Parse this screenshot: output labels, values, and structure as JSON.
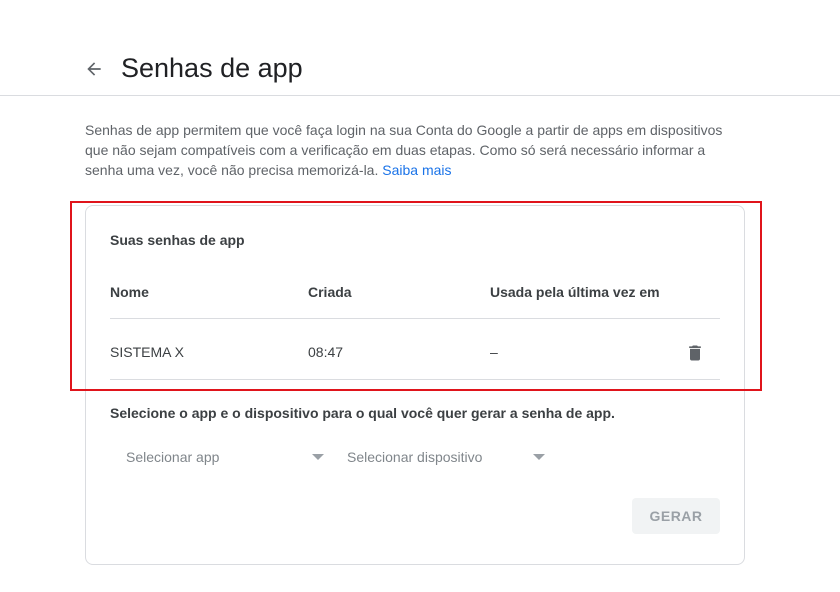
{
  "header": {
    "back_icon": "arrow-back-icon",
    "title": "Senhas de app"
  },
  "intro": {
    "text": "Senhas de app permitem que você faça login na sua Conta do Google a partir de apps em dispositivos que não sejam compatíveis com a verificação em duas etapas. Como só será necessário informar a senha uma vez, você não precisa memorizá-la.",
    "link_label": "Saiba mais"
  },
  "passwords": {
    "title": "Suas senhas de app",
    "columns": [
      "Nome",
      "Criada",
      "Usada pela última vez em"
    ],
    "rows": [
      {
        "name": "SISTEMA X",
        "created": "08:47",
        "last_used": "–",
        "delete_icon": "trash-icon"
      }
    ]
  },
  "generate": {
    "label": "Selecione o app e o dispositivo para o qual você quer gerar a senha de app.",
    "app_select": "Selecionar app",
    "device_select": "Selecionar dispositivo",
    "button_label": "GERAR"
  },
  "colors": {
    "link": "#1a73e8",
    "highlight_border": "#e0141b",
    "disabled_button_bg": "#f1f3f4"
  }
}
